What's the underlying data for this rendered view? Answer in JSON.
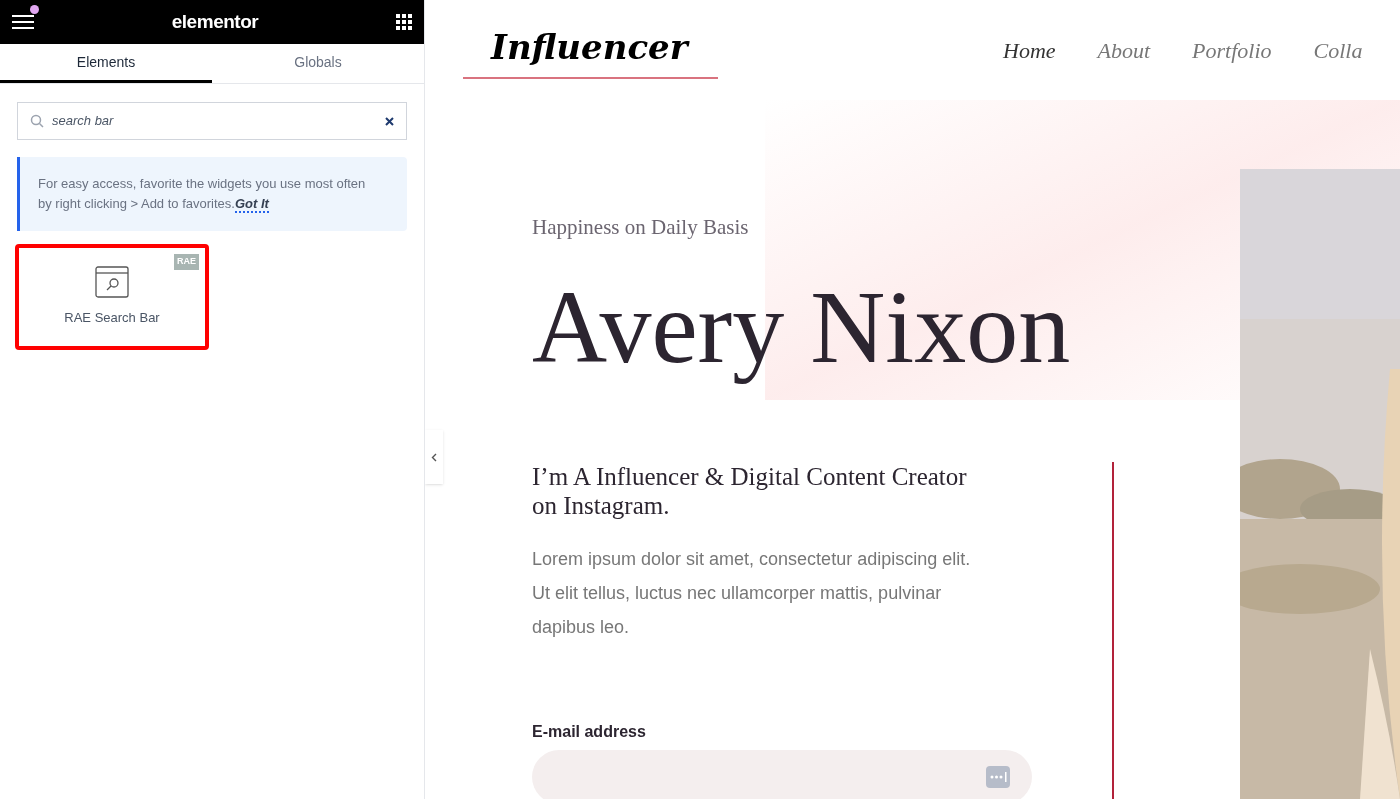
{
  "panel": {
    "title": "elementor",
    "notification": true,
    "tabs": [
      {
        "label": "Elements",
        "selected": true
      },
      {
        "label": "Globals",
        "selected": false
      }
    ],
    "search": {
      "value": "search bar"
    },
    "tip": {
      "text": "For easy access, favorite the widgets you use most often by right clicking > Add to favorites.",
      "link": "Got It"
    },
    "widgets": [
      {
        "label": "RAE Search Bar",
        "badge": "RAE",
        "highlighted": true
      }
    ]
  },
  "site": {
    "logo": "Influencer",
    "nav": [
      {
        "label": "Home",
        "selected": true
      },
      {
        "label": "About",
        "selected": false
      },
      {
        "label": "Portfolio",
        "selected": false
      },
      {
        "label": "Colla",
        "selected": false
      }
    ],
    "hero": {
      "eyebrow": "Happiness on Daily Basis",
      "name": "Avery Nixon",
      "tagline": "I’m A Influencer & Digital Content Creator on Instagram.",
      "body": "Lorem ipsum dolor sit amet, consectetur adipiscing elit. Ut elit tellus, luctus nec ullamcorper mattis, pulvinar dapibus leo.",
      "email_label": "E-mail address"
    }
  }
}
